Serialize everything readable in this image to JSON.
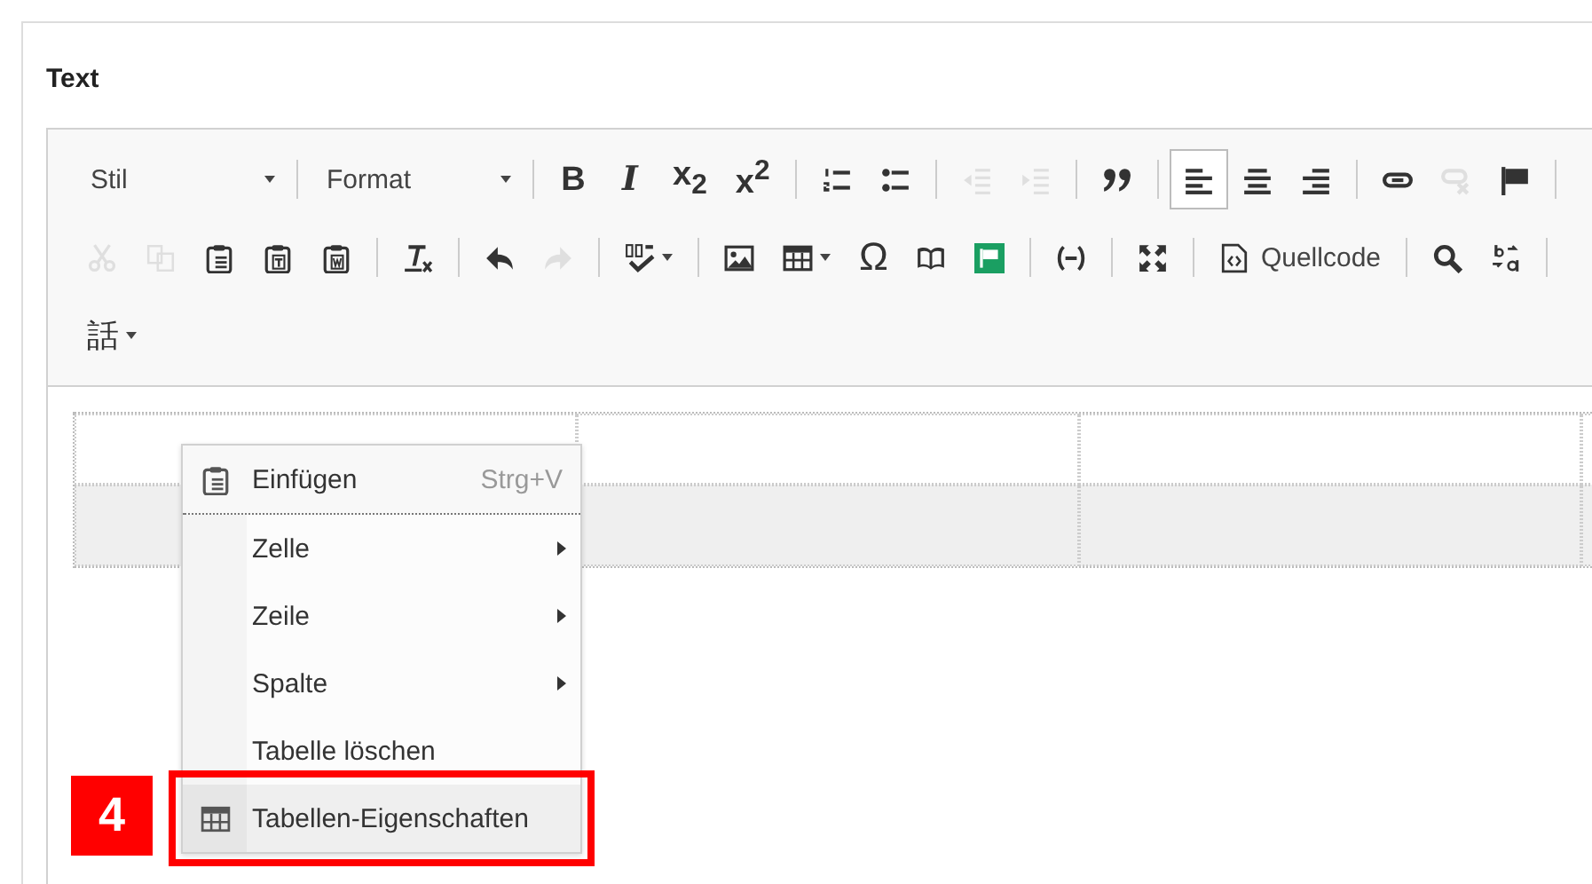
{
  "field_label": "Text",
  "toolbar": {
    "rows": [
      [
        {
          "kind": "combo",
          "label": "Stil"
        },
        {
          "kind": "separator"
        },
        {
          "kind": "combo",
          "label": "Format"
        },
        {
          "kind": "separator"
        },
        {
          "kind": "button",
          "label": "B",
          "disabled": false,
          "selected": false
        },
        {
          "kind": "button",
          "label": "I",
          "disabled": false,
          "selected": false
        },
        {
          "kind": "button",
          "label": "x$_{2}$",
          "disabled": false,
          "selected": false
        },
        {
          "kind": "button",
          "label": "x$^{2}$",
          "disabled": false,
          "selected": false
        },
        {
          "kind": "separator"
        },
        {
          "kind": "button",
          "disabled": false,
          "selected": false
        },
        {
          "kind": "button",
          "disabled": false,
          "selected": false
        },
        {
          "kind": "separator"
        },
        {
          "kind": "button",
          "disabled": true,
          "selected": false
        },
        {
          "kind": "button",
          "disabled": true,
          "selected": false
        },
        {
          "kind": "separator"
        },
        {
          "kind": "button",
          "disabled": false,
          "selected": false
        },
        {
          "kind": "separator"
        },
        {
          "kind": "button",
          "disabled": false,
          "selected": true
        },
        {
          "kind": "button",
          "disabled": false,
          "selected": false
        },
        {
          "kind": "button",
          "disabled": false,
          "selected": false
        },
        {
          "kind": "separator"
        },
        {
          "kind": "button",
          "disabled": false,
          "selected": false
        },
        {
          "kind": "button",
          "disabled": true,
          "selected": false
        },
        {
          "kind": "button",
          "disabled": false,
          "selected": false
        },
        {
          "kind": "separator"
        }
      ],
      [
        {
          "kind": "button",
          "disabled": true,
          "selected": false
        },
        {
          "kind": "button",
          "disabled": true,
          "selected": false
        },
        {
          "kind": "button",
          "disabled": false,
          "selected": false
        },
        {
          "kind": "button",
          "disabled": false,
          "selected": false
        },
        {
          "kind": "button",
          "disabled": false,
          "selected": false
        },
        {
          "kind": "separator"
        },
        {
          "kind": "button",
          "disabled": false,
          "selected": false
        },
        {
          "kind": "separator"
        },
        {
          "kind": "button",
          "disabled": false,
          "selected": false
        },
        {
          "kind": "button",
          "disabled": true,
          "selected": false
        },
        {
          "kind": "separator"
        },
        {
          "kind": "menu-button",
          "disabled": false,
          "selected": false
        },
        {
          "kind": "separator"
        },
        {
          "kind": "button",
          "disabled": false,
          "selected": false
        },
        {
          "kind": "menu-button",
          "disabled": false,
          "selected": false
        },
        {
          "kind": "button",
          "label": "Ω",
          "disabled": false,
          "selected": false
        },
        {
          "kind": "button",
          "disabled": false,
          "selected": false
        },
        {
          "kind": "button",
          "disabled": false,
          "selected": false
        },
        {
          "kind": "separator"
        },
        {
          "kind": "button",
          "disabled": false,
          "selected": false
        },
        {
          "kind": "separator"
        },
        {
          "kind": "button",
          "disabled": false,
          "selected": false
        },
        {
          "kind": "separator"
        },
        {
          "kind": "text-button",
          "label": "Quellcode",
          "disabled": false,
          "selected": false
        },
        {
          "kind": "separator"
        },
        {
          "kind": "button",
          "disabled": false,
          "selected": false
        },
        {
          "kind": "button",
          "disabled": false,
          "selected": false
        },
        {
          "kind": "separator"
        }
      ],
      [
        {
          "kind": "menu-button",
          "label": "話",
          "disabled": false,
          "selected": false
        }
      ]
    ]
  },
  "table": {
    "rows": [
      {
        "selected": false
      },
      {
        "selected": true
      }
    ]
  },
  "context_menu": {
    "items": [
      {
        "kind": "paste",
        "label": "Einfügen",
        "shortcut": "Strg+V",
        "submenu": false,
        "annotated": false
      },
      {
        "kind": "plain",
        "label": "Zelle",
        "submenu": true,
        "annotated": false
      },
      {
        "kind": "plain",
        "label": "Zeile",
        "submenu": true,
        "annotated": false
      },
      {
        "kind": "plain",
        "label": "Spalte",
        "submenu": true,
        "annotated": false
      },
      {
        "kind": "plain",
        "label": "Tabelle löschen",
        "submenu": false,
        "annotated": false
      },
      {
        "kind": "table",
        "label": "Tabellen-Eigenschaften",
        "submenu": false,
        "annotated": true
      }
    ]
  },
  "callout": {
    "number": "4"
  }
}
